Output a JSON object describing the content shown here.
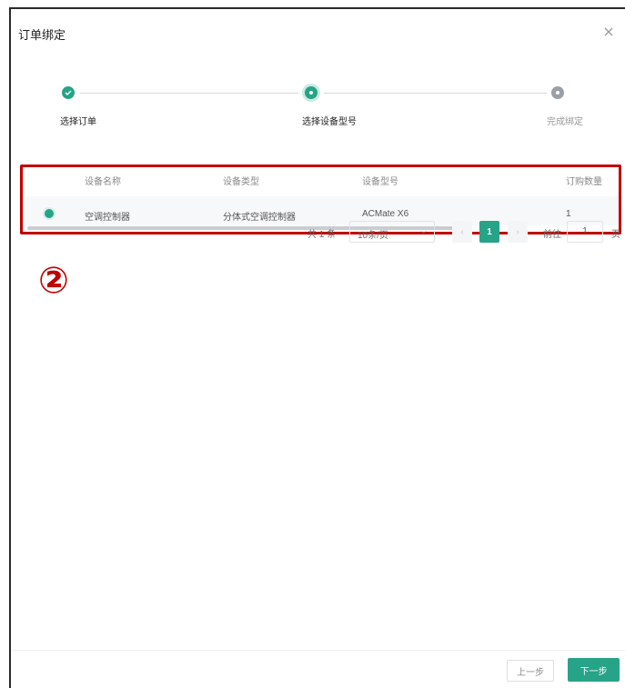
{
  "dialog": {
    "title": "订单绑定"
  },
  "steps": [
    {
      "label": "选择订单",
      "status": "done"
    },
    {
      "label": "选择设备型号",
      "status": "active"
    },
    {
      "label": "完成绑定",
      "status": "wait"
    }
  ],
  "table": {
    "headers": [
      "设备名称",
      "设备类型",
      "设备型号",
      "订购数量"
    ],
    "rows": [
      {
        "selected": true,
        "cells": [
          "空调控制器",
          "分体式空调控制器",
          "ACMate X6",
          "1"
        ]
      }
    ]
  },
  "pagination": {
    "total_text": "共 1 条",
    "page_size": "10条/页",
    "prev": "‹",
    "current_page": "1",
    "next": "›",
    "goto_label": "前往",
    "goto_value": "1",
    "suffix": "页"
  },
  "annotation": {
    "marker": "②",
    "color": "#c00000"
  },
  "footer": {
    "prev_button": "上一步",
    "next_button": "下一步"
  },
  "colors": {
    "accent": "#27a387",
    "highlight": "#c00000"
  }
}
